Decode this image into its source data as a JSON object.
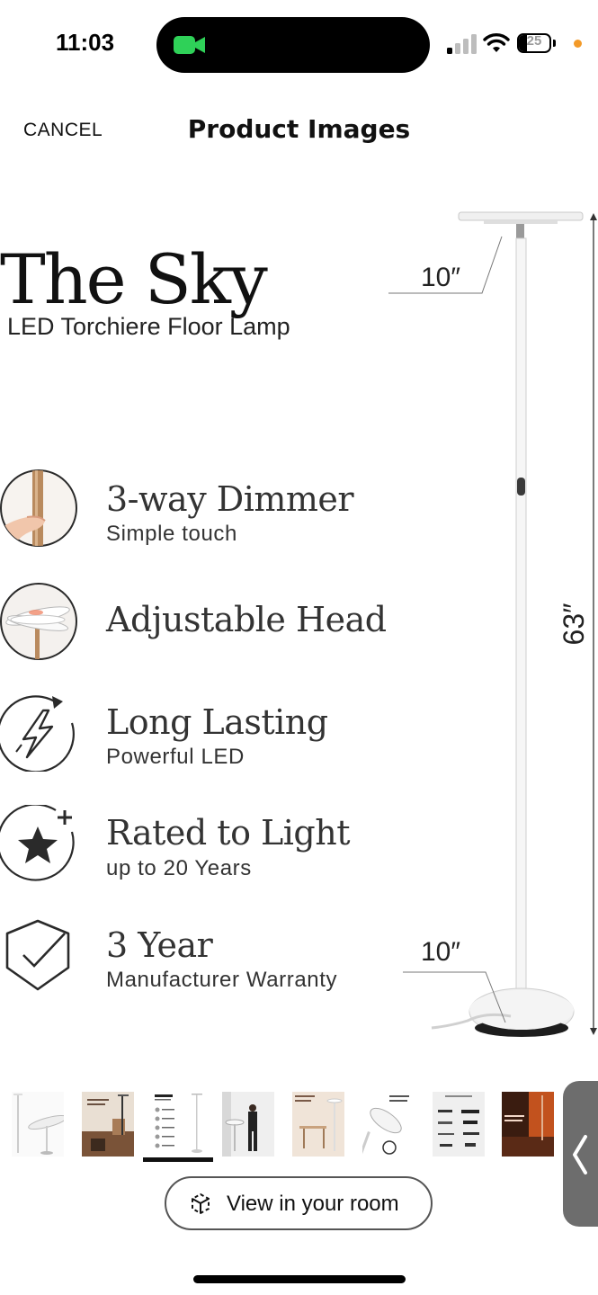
{
  "status_bar": {
    "time": "11:03",
    "battery": "25",
    "battery_level": 0.25,
    "camera_indicator_color": "#2fd158",
    "privacy_dot_color": "#f39a28"
  },
  "header": {
    "cancel_label": "CANCEL",
    "title": "Product Images"
  },
  "product_image": {
    "brand": "The Sky",
    "subtitle": "LED Torchiere Floor Lamp",
    "features": [
      {
        "icon": "touch-dimmer-icon",
        "title": "3-way Dimmer",
        "subtitle": "Simple touch"
      },
      {
        "icon": "adjustable-head-icon",
        "title": "Adjustable Head",
        "subtitle": ""
      },
      {
        "icon": "lightning-bolt-icon",
        "title": "Long Lasting",
        "subtitle": "Powerful LED"
      },
      {
        "icon": "star-plus-icon",
        "title": "Rated to Light",
        "subtitle": "up to 20 Years"
      },
      {
        "icon": "shield-check-icon",
        "title": "3 Year",
        "subtitle": "Manufacturer Warranty"
      }
    ],
    "dimensions": {
      "head_width": "10″",
      "height": "63″",
      "base_width": "10″"
    }
  },
  "thumbnails": {
    "selected_index": 2,
    "count": 8
  },
  "view_in_room": {
    "label": "View in your room",
    "icon": "ar-cube-icon"
  },
  "side_tab": {
    "icon": "chevron-left-icon"
  }
}
